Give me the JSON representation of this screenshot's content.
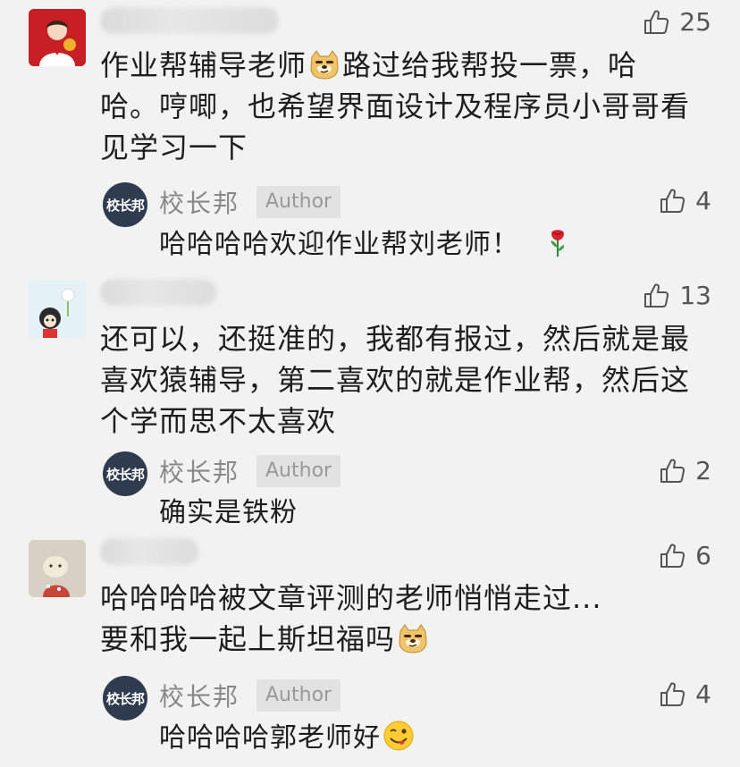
{
  "comments": [
    {
      "text_line1": "作业帮辅导老师",
      "text_line1b": "路过给我帮投一票，哈",
      "text_line2": "哈。哼唧，也希望界面设计及程序员小哥哥看",
      "text_line3": "见学习一下",
      "likes": "25",
      "reply": {
        "avatar_text": "校长邦",
        "name": "校长邦",
        "badge": "Author",
        "text": "哈哈哈哈欢迎作业帮刘老师！",
        "likes": "4"
      }
    },
    {
      "text_line1": "还可以，还挺准的，我都有报过，然后就是最",
      "text_line2": "喜欢猿辅导，第二喜欢的就是作业帮，然后这",
      "text_line3": "个学而思不太喜欢",
      "likes": "13",
      "reply": {
        "avatar_text": "校长邦",
        "name": "校长邦",
        "badge": "Author",
        "text": "确实是铁粉",
        "likes": "2"
      }
    },
    {
      "text_line1": "哈哈哈哈被文章评测的老师悄悄走过...",
      "text_line2": "要和我一起上斯坦福吗",
      "likes": "6",
      "reply": {
        "avatar_text": "校长邦",
        "name": "校长邦",
        "badge": "Author",
        "text": "哈哈哈哈郭老师好",
        "likes": "4"
      }
    }
  ],
  "colors": {
    "background": "#f2f2f2",
    "reply_avatar": "#2f3c4f",
    "badge_bg": "#e2e2e2"
  },
  "icons": [
    "thumbs-up-icon",
    "doge-emoji-icon",
    "rose-emoji-icon",
    "wink-tongue-emoji-icon"
  ]
}
